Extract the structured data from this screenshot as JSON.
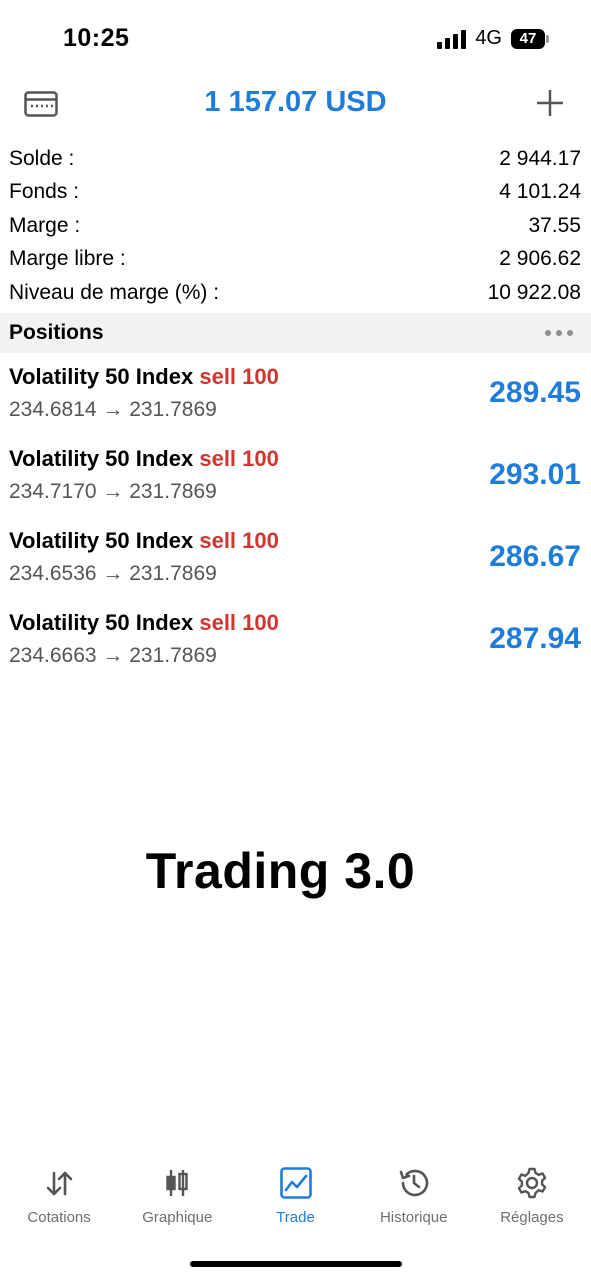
{
  "status_bar": {
    "time": "10:25",
    "network": "4G",
    "battery": "47"
  },
  "header": {
    "title": "1 157.07 USD",
    "left_icon": "account-card-icon",
    "right_icon": "plus-icon"
  },
  "summary": [
    {
      "label": "Solde :",
      "value": "2 944.17"
    },
    {
      "label": "Fonds :",
      "value": "4 101.24"
    },
    {
      "label": "Marge :",
      "value": "37.55"
    },
    {
      "label": "Marge libre :",
      "value": "2 906.62"
    },
    {
      "label": "Niveau de marge (%) :",
      "value": "10 922.08"
    }
  ],
  "positions": {
    "title": "Positions",
    "items": [
      {
        "symbol": "Volatility 50 Index",
        "side": "sell 100",
        "prices": "234.6814 → 231.7869",
        "profit": "289.45"
      },
      {
        "symbol": "Volatility 50 Index",
        "side": "sell 100",
        "prices": "234.7170 → 231.7869",
        "profit": "293.01"
      },
      {
        "symbol": "Volatility 50 Index",
        "side": "sell 100",
        "prices": "234.6536 → 231.7869",
        "profit": "286.67"
      },
      {
        "symbol": "Volatility 50 Index",
        "side": "sell 100",
        "prices": "234.6663 → 231.7869",
        "profit": "287.94"
      }
    ]
  },
  "overlay_text": "Trading 3.0",
  "tabs": [
    {
      "label": "Cotations",
      "icon": "quotes-arrows-icon"
    },
    {
      "label": "Graphique",
      "icon": "candlestick-icon"
    },
    {
      "label": "Trade",
      "icon": "trade-chart-icon",
      "active": true
    },
    {
      "label": "Historique",
      "icon": "history-clock-icon"
    },
    {
      "label": "Réglages",
      "icon": "settings-gear-icon"
    }
  ],
  "colors": {
    "accent": "#1e7ddc",
    "sell": "#d0362f",
    "tab_inactive": "#6e6e73"
  }
}
